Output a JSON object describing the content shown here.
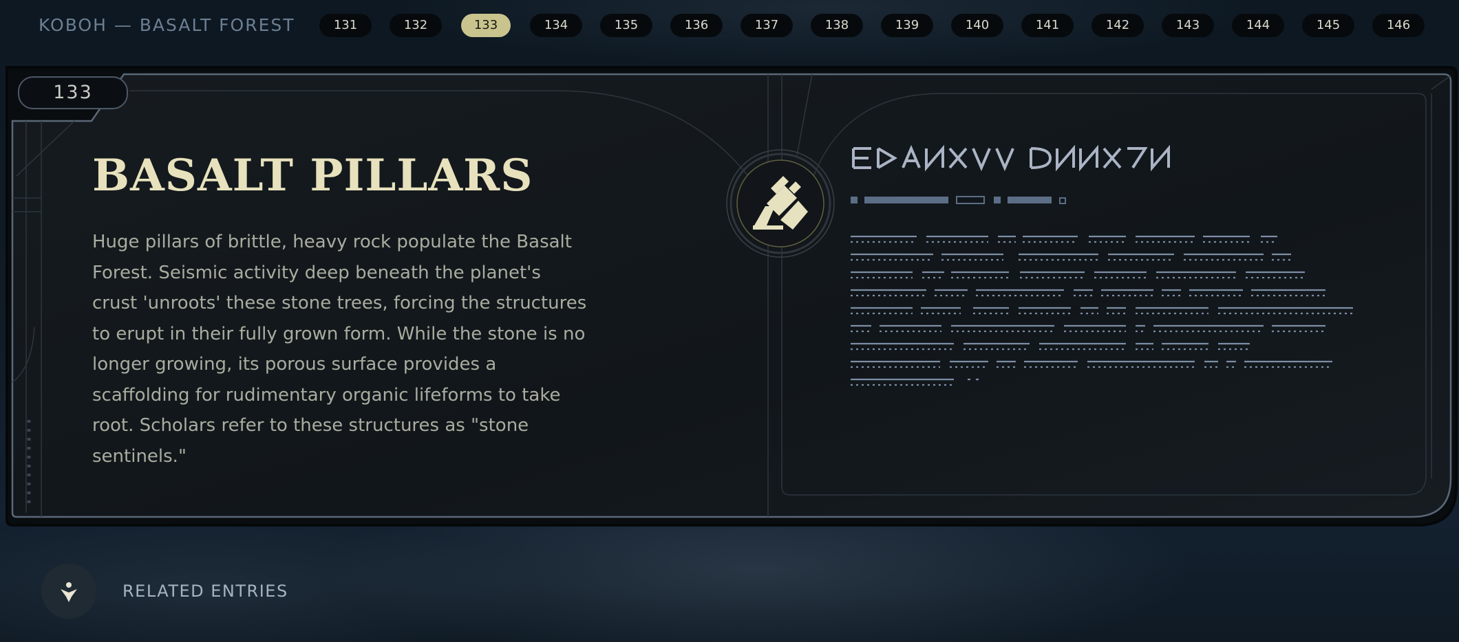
{
  "topbar": {
    "location": "KOBOH — BASALT FOREST",
    "pages": [
      "131",
      "132",
      "133",
      "134",
      "135",
      "136",
      "137",
      "138",
      "139",
      "140",
      "141",
      "142",
      "143",
      "144",
      "145",
      "146"
    ],
    "active_page": "133"
  },
  "entry": {
    "number": "133",
    "title": "BASALT PILLARS",
    "body": "Huge pillars of brittle, heavy rock populate the Basalt Forest. Seismic activity deep beneath the planet's crust 'unroots' these stone trees, forcing the structures to erupt in their fully grown form. While the stone is no longer growing, its porous surface provides a scaffolding for rudimentary organic lifeforms to take root. Scholars refer to these structures as \"stone sentinels.\"",
    "emblem_icon": "basalt-pillars-emblem-icon",
    "translation_script": "aurebesh"
  },
  "related": {
    "label": "RELATED ENTRIES",
    "icon": "related-entries-icon"
  },
  "colors": {
    "accent": "#c9c48e",
    "title": "#e7e2bd",
    "body_text": "#a9ada0",
    "aurebesh": "#8a9bb2",
    "frame": "#5a6878"
  }
}
